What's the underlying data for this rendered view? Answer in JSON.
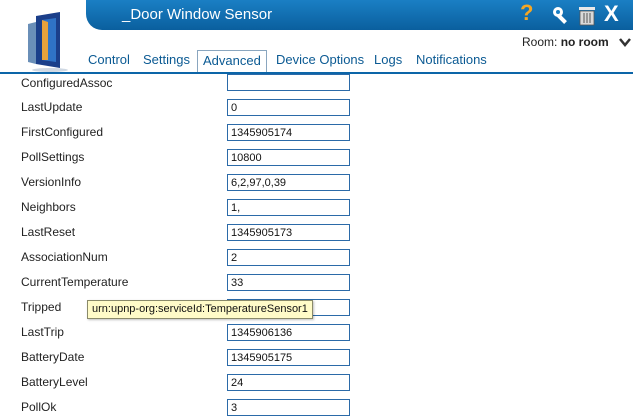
{
  "header": {
    "title": "_Door Window Sensor",
    "icons": [
      "door-device-icon",
      "help-icon",
      "wrench-icon",
      "trash-icon",
      "close-icon"
    ],
    "help_glyph": "?",
    "close_glyph": "X",
    "room_label": "Room:",
    "room_value": "no room",
    "accent": "#0c65a8"
  },
  "tabs": [
    {
      "label": "Control"
    },
    {
      "label": "Settings"
    },
    {
      "label": "Advanced",
      "active": true
    },
    {
      "label": "Device Options"
    },
    {
      "label": "Logs"
    },
    {
      "label": "Notifications"
    }
  ],
  "fields": [
    {
      "label": "ConfiguredAssoc",
      "value": ""
    },
    {
      "label": "LastUpdate",
      "value": "0"
    },
    {
      "label": "FirstConfigured",
      "value": "1345905174"
    },
    {
      "label": "PollSettings",
      "value": "10800"
    },
    {
      "label": "VersionInfo",
      "value": "6,2,97,0,39"
    },
    {
      "label": "Neighbors",
      "value": "1,"
    },
    {
      "label": "LastReset",
      "value": "1345905173"
    },
    {
      "label": "AssociationNum",
      "value": "2"
    },
    {
      "label": "CurrentTemperature",
      "value": "33"
    },
    {
      "label": "Tripped",
      "value": ""
    },
    {
      "label": "LastTrip",
      "value": "1345906136"
    },
    {
      "label": "BatteryDate",
      "value": "1345905175"
    },
    {
      "label": "BatteryLevel",
      "value": "24"
    },
    {
      "label": "PollOk",
      "value": "3"
    }
  ],
  "tooltip": {
    "text": "urn:upnp-org:serviceId:TemperatureSensor1"
  }
}
